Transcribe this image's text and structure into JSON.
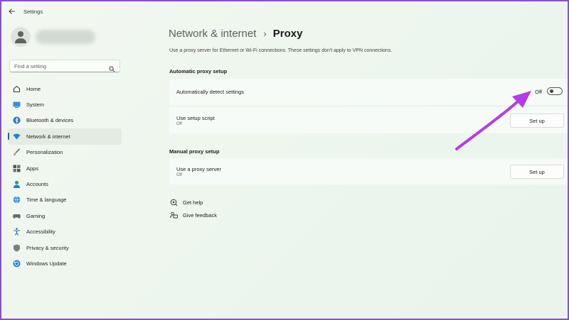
{
  "window": {
    "title": "Settings",
    "back_icon": "back-arrow-icon"
  },
  "search": {
    "placeholder": "Find a setting",
    "icon": "search-icon"
  },
  "sidebar": {
    "items": [
      {
        "label": "Home",
        "icon": "home-icon",
        "active": false
      },
      {
        "label": "System",
        "icon": "system-icon",
        "active": false
      },
      {
        "label": "Bluetooth & devices",
        "icon": "bluetooth-icon",
        "active": false
      },
      {
        "label": "Network & internet",
        "icon": "wifi-icon",
        "active": true
      },
      {
        "label": "Personalization",
        "icon": "brush-icon",
        "active": false
      },
      {
        "label": "Apps",
        "icon": "apps-icon",
        "active": false
      },
      {
        "label": "Accounts",
        "icon": "accounts-icon",
        "active": false
      },
      {
        "label": "Time & language",
        "icon": "globe-clock-icon",
        "active": false
      },
      {
        "label": "Gaming",
        "icon": "gamepad-icon",
        "active": false
      },
      {
        "label": "Accessibility",
        "icon": "accessibility-icon",
        "active": false
      },
      {
        "label": "Privacy & security",
        "icon": "shield-icon",
        "active": false
      },
      {
        "label": "Windows Update",
        "icon": "update-icon",
        "active": false
      }
    ]
  },
  "header": {
    "parent": "Network & internet",
    "separator": "›",
    "current": "Proxy"
  },
  "description": "Use a proxy server for Ethernet or Wi-Fi connections. These settings don't apply to VPN connections.",
  "automatic": {
    "title": "Automatic proxy setup",
    "detect": {
      "label": "Automatically detect settings",
      "state_label": "Off",
      "on": false
    },
    "script": {
      "label": "Use setup script",
      "status": "Off",
      "button": "Set up"
    }
  },
  "manual": {
    "title": "Manual proxy setup",
    "server": {
      "label": "Use a proxy server",
      "status": "Off",
      "button": "Set up"
    }
  },
  "links": {
    "help": "Get help",
    "feedback": "Give feedback"
  },
  "colors": {
    "accent": "#2b5f9e",
    "annotation_arrow": "#b23ee6",
    "frame": "#8a4fd0"
  }
}
